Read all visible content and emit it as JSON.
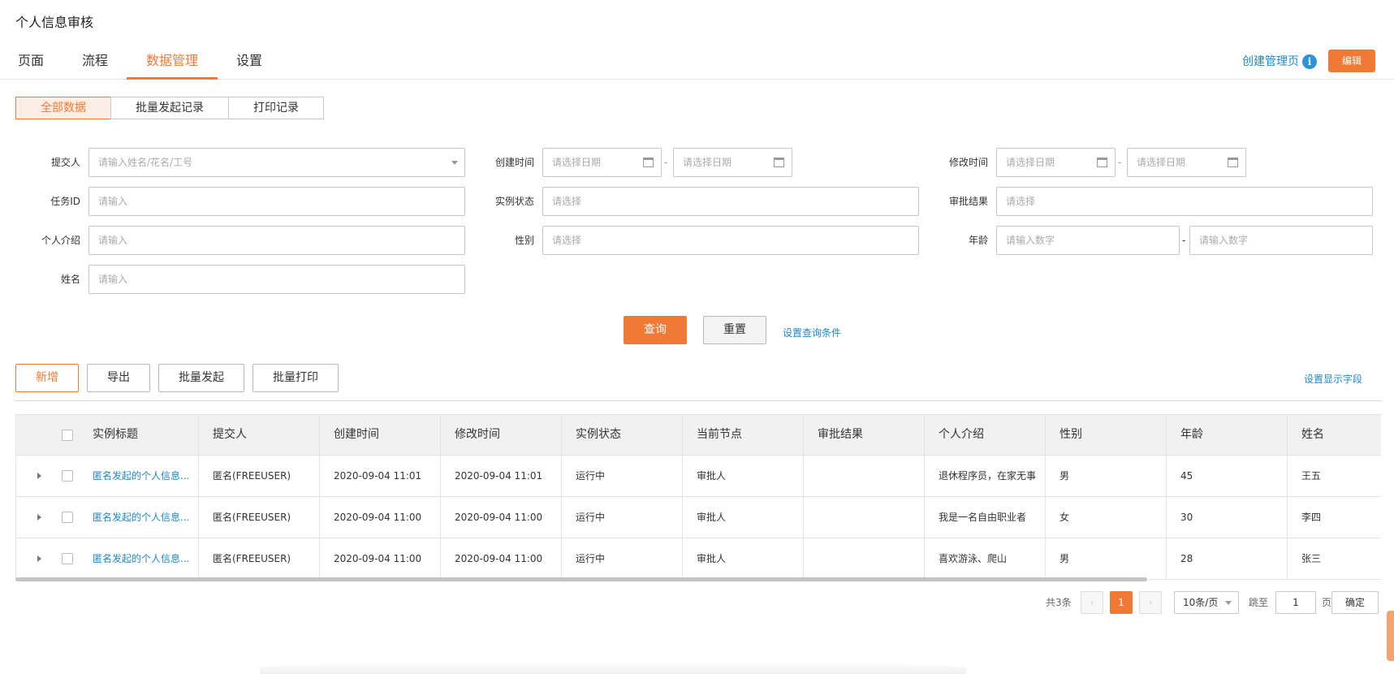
{
  "app": {
    "title": "个人信息审核"
  },
  "tabs": [
    {
      "label": "页面"
    },
    {
      "label": "流程"
    },
    {
      "label": "数据管理"
    },
    {
      "label": "设置"
    }
  ],
  "header_right": {
    "create_link": "创建管理页",
    "info_icon_glyph": "i",
    "edit_button": "编辑"
  },
  "view_switch": [
    {
      "label": "全部数据"
    },
    {
      "label": "批量发起记录"
    },
    {
      "label": "打印记录"
    }
  ],
  "filters": {
    "submitter": {
      "label": "提交人",
      "placeholder": "请输入姓名/花名/工号"
    },
    "created": {
      "label": "创建时间",
      "start_placeholder": "请选择日期",
      "end_placeholder": "请选择日期",
      "separator": "-"
    },
    "modified": {
      "label": "修改时间",
      "start_placeholder": "请选择日期",
      "end_placeholder": "请选择日期",
      "separator": "-"
    },
    "task_id": {
      "label": "任务ID",
      "placeholder": "请输入"
    },
    "instance_status": {
      "label": "实例状态",
      "placeholder": "请选择"
    },
    "approval_result": {
      "label": "审批结果",
      "placeholder": "请选择"
    },
    "intro": {
      "label": "个人介绍",
      "placeholder": "请输入"
    },
    "gender": {
      "label": "性别",
      "placeholder": "请选择"
    },
    "age": {
      "label": "年龄",
      "min_placeholder": "请输入数字",
      "max_placeholder": "请输入数字",
      "separator": "-"
    },
    "name": {
      "label": "姓名",
      "placeholder": "请输入"
    }
  },
  "query_actions": {
    "query": "查询",
    "reset": "重置",
    "set_conditions": "设置查询条件"
  },
  "toolbar": {
    "add": "新增",
    "export": "导出",
    "batch_start": "批量发起",
    "batch_print": "批量打印",
    "set_fields": "设置显示字段"
  },
  "table": {
    "columns": [
      "实例标题",
      "提交人",
      "创建时间",
      "修改时间",
      "实例状态",
      "当前节点",
      "审批结果",
      "个人介绍",
      "性别",
      "年龄",
      "姓名"
    ],
    "rows": [
      {
        "title": "匿名发起的个人信息...",
        "submitter": "匿名(FREEUSER)",
        "created": "2020-09-04 11:01",
        "modified": "2020-09-04 11:01",
        "status": "运行中",
        "node": "审批人",
        "result": "",
        "intro": "退休程序员，在家无事",
        "gender": "男",
        "age": "45",
        "name": "王五"
      },
      {
        "title": "匿名发起的个人信息...",
        "submitter": "匿名(FREEUSER)",
        "created": "2020-09-04 11:00",
        "modified": "2020-09-04 11:00",
        "status": "运行中",
        "node": "审批人",
        "result": "",
        "intro": "我是一名自由职业者",
        "gender": "女",
        "age": "30",
        "name": "李四"
      },
      {
        "title": "匿名发起的个人信息...",
        "submitter": "匿名(FREEUSER)",
        "created": "2020-09-04 11:00",
        "modified": "2020-09-04 11:00",
        "status": "运行中",
        "node": "审批人",
        "result": "",
        "intro": "喜欢游泳、爬山",
        "gender": "男",
        "age": "28",
        "name": "张三"
      }
    ]
  },
  "pagination": {
    "total": "共3条",
    "prev": "‹",
    "current_page": "1",
    "next": "›",
    "page_size": "10条/页",
    "jump_label": "跳至",
    "jump_value": "1",
    "page_unit": "页",
    "confirm": "确定"
  },
  "colors": {
    "accent": "#f07a35",
    "link": "#1e88c8"
  }
}
